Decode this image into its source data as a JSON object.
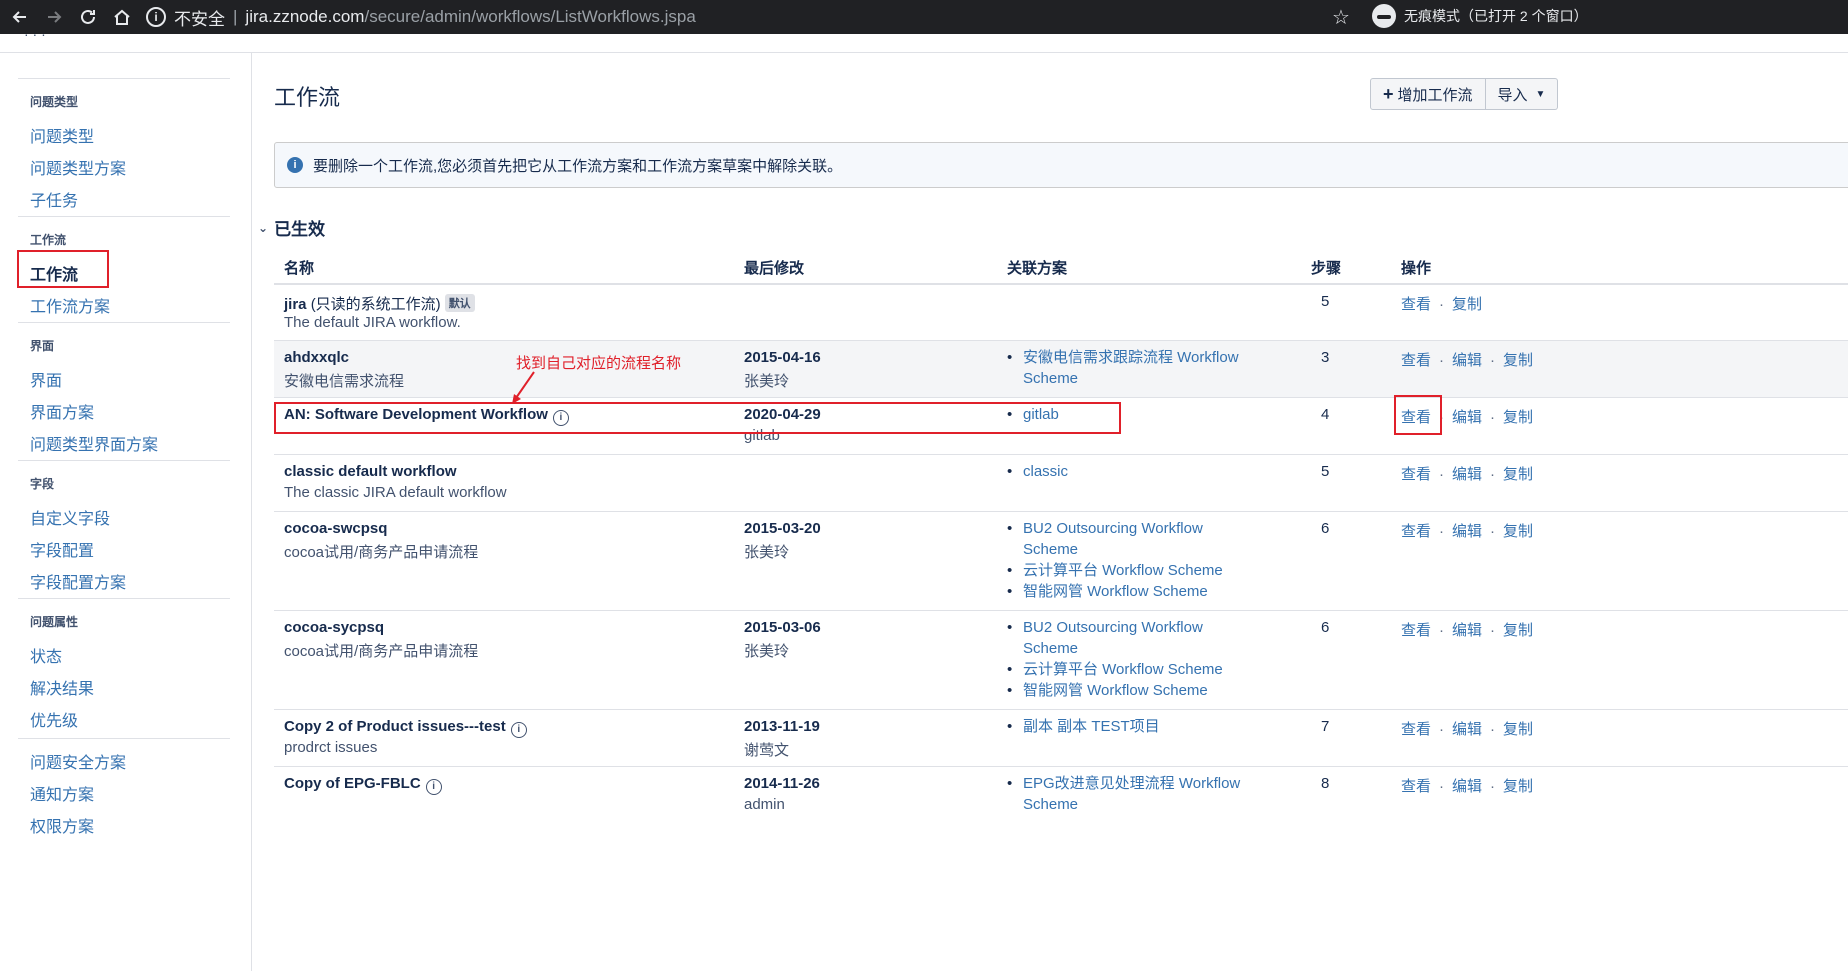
{
  "browser": {
    "insecure_label": "不安全",
    "url_host": "jira.zznode.com",
    "url_path": "/secure/admin/workflows/ListWorkflows.jspa",
    "incognito_label": "无痕模式（已打开 2 个窗口）"
  },
  "sidebar": {
    "groups": [
      {
        "heading": "问题类型",
        "items": [
          "问题类型",
          "问题类型方案",
          "子任务"
        ]
      },
      {
        "heading": "工作流",
        "items": [
          "工作流",
          "工作流方案"
        ]
      },
      {
        "heading": "界面",
        "items": [
          "界面",
          "界面方案",
          "问题类型界面方案"
        ]
      },
      {
        "heading": "字段",
        "items": [
          "自定义字段",
          "字段配置",
          "字段配置方案"
        ]
      },
      {
        "heading": "问题属性",
        "items": [
          "状态",
          "解决结果",
          "优先级"
        ]
      },
      {
        "heading": "",
        "items": [
          "问题安全方案",
          "通知方案",
          "权限方案"
        ]
      }
    ],
    "active_item": "工作流"
  },
  "page": {
    "title": "工作流",
    "add_button": "增加工作流",
    "import_button": "导入",
    "info_message": "要删除一个工作流,您必须首先把它从工作流方案和工作流方案草案中解除关联。",
    "section_title": "已生效",
    "annotation": "找到自己对应的流程名称"
  },
  "table": {
    "headers": {
      "name": "名称",
      "modified": "最后修改",
      "schemes": "关联方案",
      "steps": "步骤",
      "actions": "操作"
    },
    "actions": {
      "view": "查看",
      "edit": "编辑",
      "copy": "复制"
    },
    "rows": [
      {
        "name": "jira",
        "name_suffix": "(只读的系统工作流)",
        "badge": "默认",
        "desc": "The default JIRA workflow.",
        "date": "",
        "author": "",
        "schemes": [],
        "steps": "5"
      },
      {
        "name": "ahdxxqlc",
        "desc": "安徽电信需求流程",
        "date": "2015-04-16",
        "author": "张美玲",
        "schemes": [
          "安徽电信需求跟踪流程 Workflow Scheme"
        ],
        "steps": "3"
      },
      {
        "name": "AN: Software Development Workflow",
        "desc": "",
        "date": "2020-04-29",
        "author": "gitlab",
        "schemes": [
          "gitlab"
        ],
        "steps": "4"
      },
      {
        "name": "classic default workflow",
        "desc": "The classic JIRA default workflow",
        "date": "",
        "author": "",
        "schemes": [
          "classic"
        ],
        "steps": "5"
      },
      {
        "name": "cocoa-swcpsq",
        "desc": "cocoa试用/商务产品申请流程",
        "date": "2015-03-20",
        "author": "张美玲",
        "schemes": [
          "BU2 Outsourcing Workflow Scheme",
          "云计算平台 Workflow Scheme",
          "智能网管 Workflow Scheme"
        ],
        "steps": "6"
      },
      {
        "name": "cocoa-sycpsq",
        "desc": "cocoa试用/商务产品申请流程",
        "date": "2015-03-06",
        "author": "张美玲",
        "schemes": [
          "BU2 Outsourcing Workflow Scheme",
          "云计算平台 Workflow Scheme",
          "智能网管 Workflow Scheme"
        ],
        "steps": "6"
      },
      {
        "name": "Copy 2 of Product issues---test",
        "desc": "prodrct issues",
        "date": "2013-11-19",
        "author": "谢莺文",
        "schemes": [
          "副本 副本 TEST项目"
        ],
        "steps": "7"
      },
      {
        "name": "Copy of EPG-FBLC",
        "desc": "",
        "date": "2014-11-26",
        "author": "admin",
        "schemes": [
          "EPG改进意见处理流程 Workflow Scheme"
        ],
        "steps": "8"
      }
    ]
  },
  "colors": {
    "link": "#3572b0",
    "highlight": "#e0202a",
    "row_shade": "#f4f5f7"
  }
}
